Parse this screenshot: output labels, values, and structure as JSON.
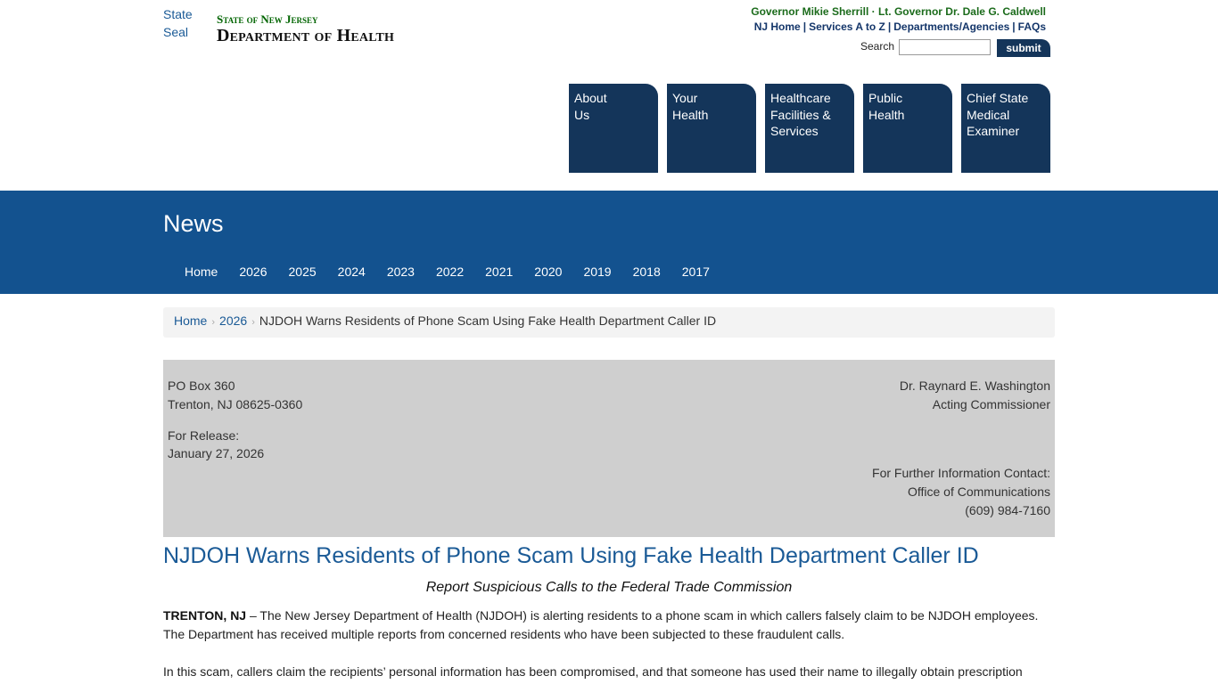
{
  "header": {
    "seal_alt": "State Seal",
    "state_name": "State of New Jersey",
    "department": "Department of Health",
    "governor_line": "Governor Mikie Sherrill · Lt. Governor Dr. Dale G. Caldwell",
    "util_links": [
      "NJ Home",
      "Services A to Z",
      "Departments/Agencies",
      "FAQs"
    ],
    "search_label": "Search",
    "search_value": "",
    "search_button": "submit"
  },
  "nav_tabs": [
    {
      "label": "About\nUs"
    },
    {
      "label": "Your\nHealth"
    },
    {
      "label": "Healthcare\nFacilities &\nServices"
    },
    {
      "label": "Public\nHealth"
    },
    {
      "label": "Chief State\nMedical\nExaminer"
    }
  ],
  "news": {
    "title": "News",
    "years": [
      "Home",
      "2026",
      "2025",
      "2024",
      "2023",
      "2022",
      "2021",
      "2020",
      "2019",
      "2018",
      "2017"
    ]
  },
  "breadcrumb": {
    "home": "Home",
    "year": "2026",
    "current": "NJDOH Warns Residents of Phone Scam Using Fake Health Department Caller ID"
  },
  "release": {
    "address_line1": "PO Box 360",
    "address_line2": "Trenton, NJ 08625-0360",
    "release_label": "For Release:",
    "release_date": "January 27, 2026",
    "commissioner_name": "Dr. Raynard E. Washington",
    "commissioner_title": "Acting Commissioner",
    "contact_label": "For Further Information Contact:",
    "contact_office": "Office of Communications",
    "contact_phone": "(609) 984-7160"
  },
  "article": {
    "headline": "NJDOH Warns Residents of Phone Scam Using Fake Health Department Caller ID",
    "subhead": "Report Suspicious Calls to the Federal Trade Commission",
    "dateline": "TRENTON, NJ",
    "para1_line1": " – The New Jersey Department of Health (NJDOH) is alerting residents to a phone scam in which callers falsely claim to be NJDOH employees.",
    "para1_line2": "The Department has received multiple reports from concerned residents who have been subjected to these fraudulent calls.",
    "para2_line1": "In this scam, callers claim the recipients’ personal information has been compromised, and that someone has used their name to illegally obtain prescription"
  },
  "colors": {
    "nav_tab": "#14355a",
    "news_band": "#13528f",
    "link": "#1a5a96",
    "governor_green": "#1b6b1b",
    "info_box": "#cfcfcf"
  }
}
